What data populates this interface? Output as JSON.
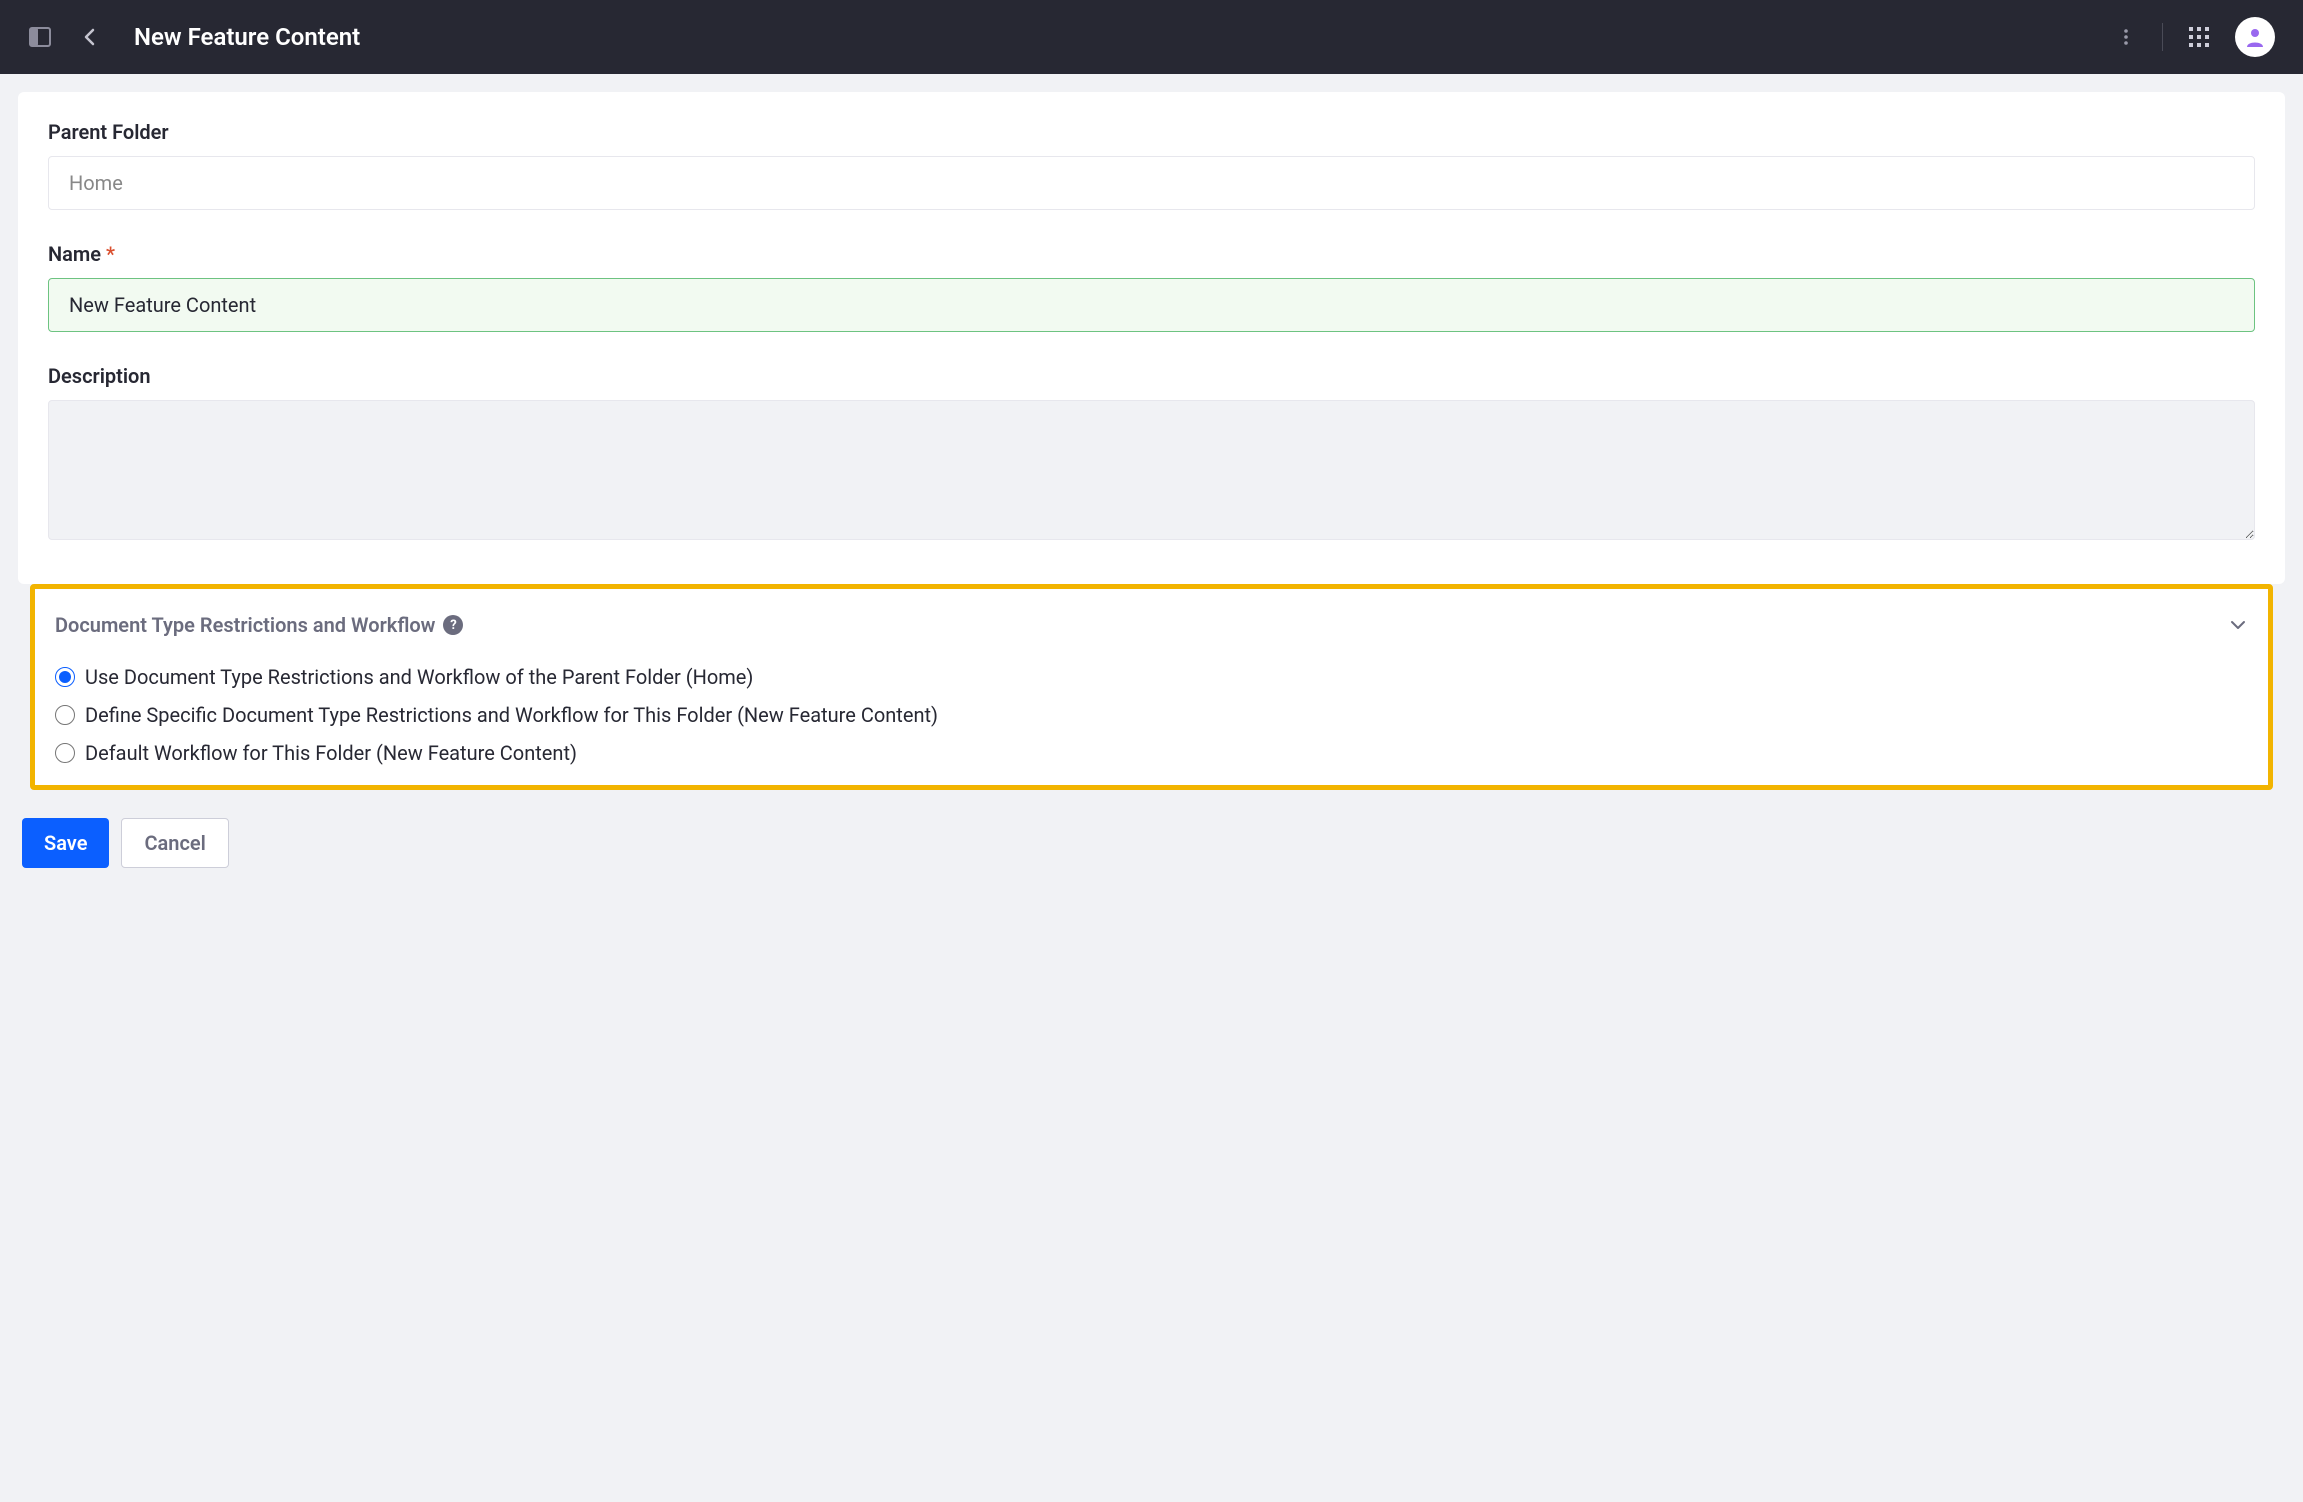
{
  "header": {
    "title": "New Feature Content"
  },
  "form": {
    "parent_folder": {
      "label": "Parent Folder",
      "value": "Home"
    },
    "name": {
      "label": "Name",
      "value": "New Feature Content"
    },
    "description": {
      "label": "Description",
      "value": ""
    }
  },
  "section": {
    "title": "Document Type Restrictions and Workflow",
    "options": [
      {
        "label": "Use Document Type Restrictions and Workflow of the Parent Folder (Home)"
      },
      {
        "label": "Define Specific Document Type Restrictions and Workflow for This Folder (New Feature Content)"
      },
      {
        "label": "Default Workflow for This Folder (New Feature Content)"
      }
    ]
  },
  "buttons": {
    "save": "Save",
    "cancel": "Cancel"
  }
}
